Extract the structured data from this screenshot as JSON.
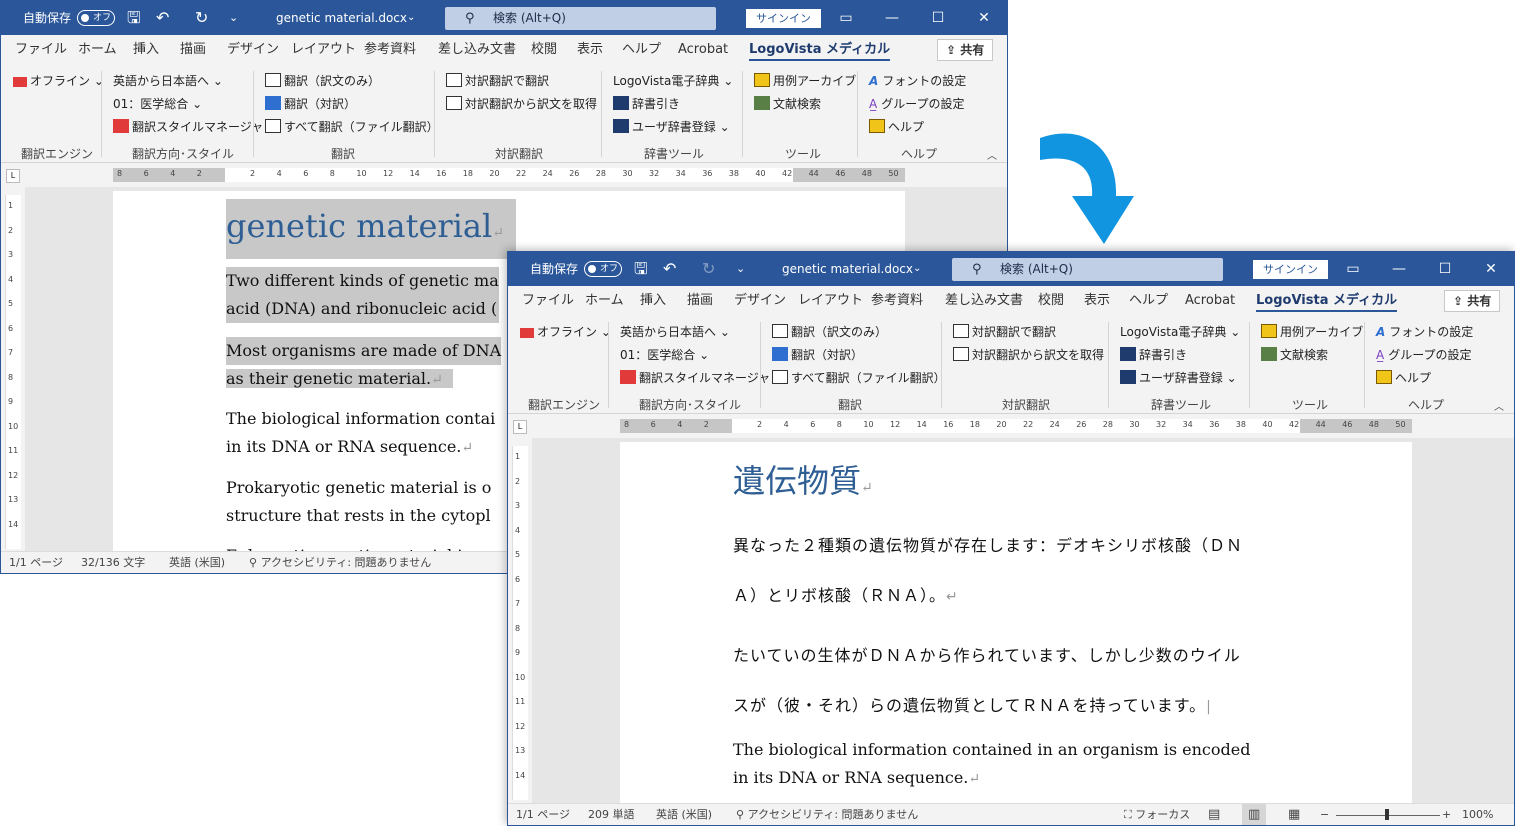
{
  "app": {
    "autosave_label": "自動保存",
    "autosave_state": "オフ",
    "filename": "genetic material.docx",
    "search_placeholder": "検索 (Alt+Q)",
    "signin_label": "サインイン",
    "share_label": "共有",
    "accent": "#2b579a"
  },
  "tabs": [
    {
      "label": "ファイル"
    },
    {
      "label": "ホーム"
    },
    {
      "label": "挿入"
    },
    {
      "label": "描画"
    },
    {
      "label": "デザイン"
    },
    {
      "label": "レイアウト"
    },
    {
      "label": "参考資料"
    },
    {
      "label": "差し込み文書"
    },
    {
      "label": "校閲"
    },
    {
      "label": "表示"
    },
    {
      "label": "ヘルプ"
    },
    {
      "label": "Acrobat"
    },
    {
      "label": "LogoVista メディカル",
      "active": true
    }
  ],
  "ribbon": {
    "engine": {
      "offline": "オフライン",
      "group": "翻訳エンジン"
    },
    "direction": {
      "lang": "英語から日本語へ",
      "field": "01：医学総合",
      "style_manager": "翻訳スタイルマネージャ",
      "group": "翻訳方向･スタイル"
    },
    "translate": {
      "only": "翻訳（訳文のみ）",
      "pair": "翻訳（対訳）",
      "all": "すべて翻訳（ファイル翻訳）",
      "group": "翻訳"
    },
    "parallel": {
      "by_parallel": "対訳翻訳で翻訳",
      "get_from_parallel": "対訳翻訳から訳文を取得",
      "group": "対訳翻訳"
    },
    "dictionary": {
      "lv_dict": "LogoVista電子辞典",
      "lookup": "辞書引き",
      "user_dict": "ユーザ辞書登録",
      "group": "辞書ツール"
    },
    "tools": {
      "archive": "用例アーカイブ",
      "lit_search": "文献検索",
      "group": "ツール"
    },
    "help": {
      "font": "フォントの設定",
      "group_settings": "グループの設定",
      "help": "ヘルプ",
      "group": "ヘルプ"
    }
  },
  "ruler_ticks": [
    "8",
    "6",
    "4",
    "2",
    "",
    "2",
    "4",
    "6",
    "8",
    "10",
    "12",
    "14",
    "16",
    "18",
    "20",
    "22",
    "24",
    "26",
    "28",
    "30",
    "32",
    "34",
    "36",
    "38",
    "40",
    "42",
    "44",
    "46",
    "48",
    "50"
  ],
  "vruler_ticks": [
    "1",
    "2",
    "3",
    "4",
    "5",
    "6",
    "7",
    "8",
    "9",
    "10",
    "11",
    "12",
    "13",
    "14"
  ],
  "doc_en": {
    "title": "genetic material",
    "p1_l1": "Two different kinds of genetic ma",
    "p1_l2": "acid (DNA) and ribonucleic acid (",
    "p2_l1": "Most organisms are made of DNA",
    "p2_l2": "as their genetic material.",
    "p3_l1": "The biological information contai",
    "p3_l2": "in its DNA or RNA sequence.",
    "p4_l1": "Prokaryotic genetic material is o",
    "p4_l2": "structure that rests in the cytopl",
    "p5_l1": "Eukaryotic genetic material is m"
  },
  "doc_jp": {
    "title": "遺伝物質",
    "p1_l1": "異なった２種類の遺伝物質が存在します：デオキシリボ核酸（ＤＮ",
    "p1_l2": "Ａ）とリボ核酸（ＲＮＡ）。",
    "p2_l1": "たいていの生体がＤＮＡから作られています、しかし少数のウイル",
    "p2_l2": "スが（彼・それ）らの遺伝物質としてＲＮＡを持っています。",
    "p3_l1": "The biological information contained in an organism is encoded",
    "p3_l2": "in its DNA or RNA sequence."
  },
  "status1": {
    "page": "1/1 ページ",
    "words": "32/136 文字",
    "lang": "英語 (米国)",
    "access": "アクセシビリティ: 問題ありません"
  },
  "status2": {
    "page": "1/1 ページ",
    "words": "209 単語",
    "lang": "英語 (米国)",
    "access": "アクセシビリティ: 問題ありません",
    "focus": "フォーカス",
    "zoom": "100%"
  }
}
